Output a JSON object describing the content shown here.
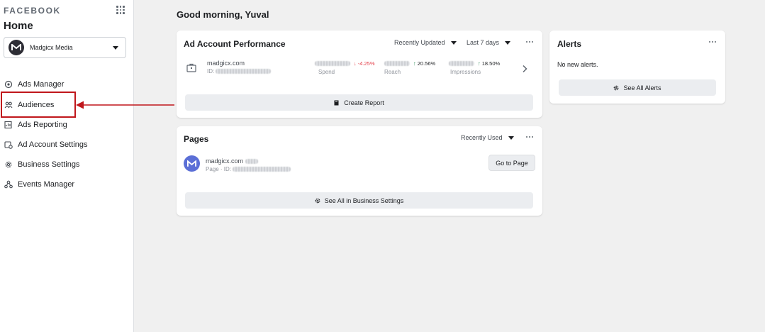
{
  "sidebar": {
    "brand": "FACEBOOK",
    "title": "Home",
    "account": {
      "name": "Madgicx Media",
      "avatar_letter": "M"
    },
    "items": [
      {
        "label": "Ads Manager",
        "icon": "ads-manager-icon"
      },
      {
        "label": "Audiences",
        "icon": "audiences-icon"
      },
      {
        "label": "Ads Reporting",
        "icon": "ads-reporting-icon"
      },
      {
        "label": "Ad Account Settings",
        "icon": "ad-account-settings-icon"
      },
      {
        "label": "Business Settings",
        "icon": "gear-icon"
      },
      {
        "label": "Events Manager",
        "icon": "events-manager-icon"
      }
    ],
    "highlighted_item": "Audiences",
    "highlight_color": "#c0171c"
  },
  "main": {
    "greeting": "Good morning, Yuval",
    "performance": {
      "title": "Ad Account Performance",
      "sort_label": "Recently Updated",
      "range_label": "Last 7 days",
      "account_name": "madgicx.com",
      "account_id_prefix": "ID:",
      "metrics": [
        {
          "label": "Spend",
          "change": "-4.25%",
          "direction": "down"
        },
        {
          "label": "Reach",
          "change": "20.56%",
          "direction": "up"
        },
        {
          "label": "Impressions",
          "change": "18.50%",
          "direction": "up"
        }
      ],
      "button_label": "Create Report"
    },
    "pages": {
      "title": "Pages",
      "sort_label": "Recently Used",
      "page_name": "madgicx.com",
      "page_id_prefix": "Page · ID:",
      "go_button": "Go to Page",
      "all_button": "See All in Business Settings"
    },
    "alerts": {
      "title": "Alerts",
      "empty_text": "No new alerts.",
      "button_label": "See All Alerts"
    }
  },
  "colors": {
    "avatar_bg": "#5b6fd6",
    "down": "#e4414b",
    "up": "#2e8b57"
  }
}
